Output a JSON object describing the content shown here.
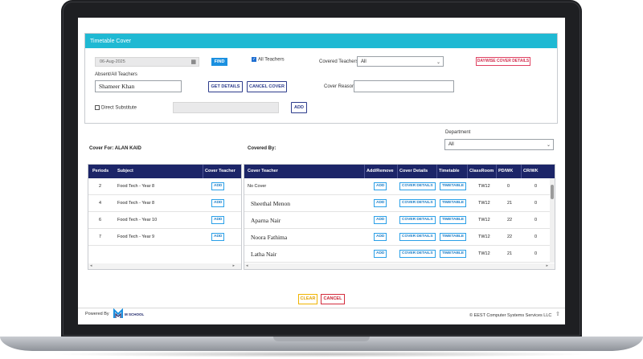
{
  "panel": {
    "title": "Timetable Cover",
    "date_value": "06-Aug-2025",
    "find_label": "FIND",
    "all_teachers_label": "All Teachers",
    "covered_teachers_label": "Covered Teachers",
    "covered_teachers_value": "All",
    "daywise_label": "DAYWISE COVER DETAILS",
    "absent_label": "Absent/All Teachers",
    "absent_value": "Shameer Khan",
    "get_details_label": "GET DETAILS",
    "cancel_cover_label": "CANCEL COVER",
    "cover_reason_label": "Cover Reason",
    "cover_reason_value": "",
    "direct_substitute_label": "Direct Substitute",
    "add_label": "ADD"
  },
  "department": {
    "label": "Department",
    "value": "All"
  },
  "cover_for_label": "Cover For: ALAN KAID",
  "covered_by_label": "Covered By:",
  "left_table": {
    "headers": [
      "Periods",
      "Subject",
      "Cover Teacher"
    ],
    "rows": [
      {
        "period": "2",
        "subject": "Food Tech - Year 8",
        "action": "ADD"
      },
      {
        "period": "4",
        "subject": "Food Tech - Year 8",
        "action": "ADD"
      },
      {
        "period": "6",
        "subject": "Food Tech - Year 10",
        "action": "ADD"
      },
      {
        "period": "7",
        "subject": "Food Tech - Year 9",
        "action": "ADD"
      }
    ]
  },
  "right_table": {
    "headers": [
      "Cover Teacher",
      "Add/Remove",
      "Cover Details",
      "Timetable",
      "ClassRoom",
      "PD/WK",
      "CR/WK"
    ],
    "rows": [
      {
        "teacher": "No Cover",
        "add": "ADD",
        "details": "COVER DETAILS",
        "timetable": "TIMETABLE",
        "room": "TW12",
        "pd": "0",
        "cr": "0"
      },
      {
        "teacher": "Sheethal Menon",
        "add": "ADD",
        "details": "COVER DETAILS",
        "timetable": "TIMETABLE",
        "room": "TW12",
        "pd": "21",
        "cr": "0"
      },
      {
        "teacher": "Aparna Nair",
        "add": "ADD",
        "details": "COVER DETAILS",
        "timetable": "TIMETABLE",
        "room": "TW12",
        "pd": "22",
        "cr": "0"
      },
      {
        "teacher": "Noora Fathima",
        "add": "ADD",
        "details": "COVER DETAILS",
        "timetable": "TIMETABLE",
        "room": "TW12",
        "pd": "22",
        "cr": "0"
      },
      {
        "teacher": "Latha Nair",
        "add": "ADD",
        "details": "COVER DETAILS",
        "timetable": "TIMETABLE",
        "room": "TW12",
        "pd": "21",
        "cr": "0"
      }
    ]
  },
  "footer": {
    "clear_label": "CLEAR",
    "cancel_label": "CANCEL",
    "powered_by": "Powered By",
    "brand": "M SCHOOL",
    "copyright": "© EEST Computer Systems Services LLC"
  }
}
